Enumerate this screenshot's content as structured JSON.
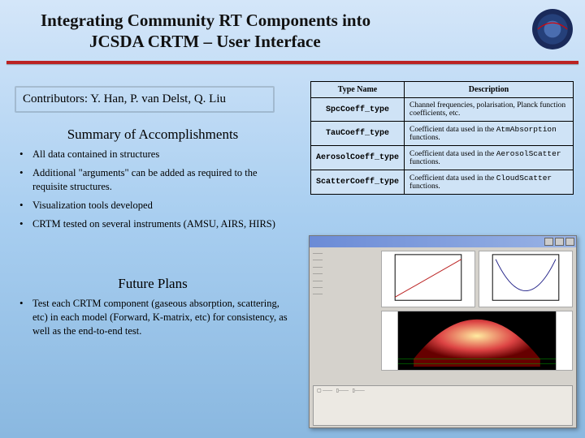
{
  "title_line1": "Integrating Community RT Components into",
  "title_line2": "JCSDA CRTM – User Interface",
  "contributors": "Contributors: Y. Han, P. van Delst, Q. Liu",
  "summary_heading": "Summary of Accomplishments",
  "summary_items": [
    "All data contained in structures",
    "Additional \"arguments\" can be added as required to the requisite structures.",
    "Visualization tools developed",
    "CRTM tested on several instruments (AMSU, AIRS, HIRS)"
  ],
  "future_heading": "Future Plans",
  "future_items": [
    "Test each CRTM component (gaseous absorption, scattering, etc) in each model (Forward, K-matrix, etc) for consistency, as well as the end-to-end test."
  ],
  "table": {
    "headers": [
      "Type Name",
      "Description"
    ],
    "rows": [
      {
        "type": "SpcCoeff_type",
        "desc_pre": "Channel frequencies, polarisation, Planck function coefficients, etc.",
        "mono": "",
        "desc_post": ""
      },
      {
        "type": "TauCoeff_type",
        "desc_pre": "Coefficient data used in the ",
        "mono": "AtmAbsorption",
        "desc_post": " functions."
      },
      {
        "type": "AerosolCoeff_type",
        "desc_pre": "Coefficient data used in the ",
        "mono": "AerosolScatter",
        "desc_post": " functions."
      },
      {
        "type": "ScatterCoeff_type",
        "desc_pre": "Coefficient data used in the ",
        "mono": "CloudScatter",
        "desc_post": " functions."
      }
    ]
  },
  "logo_alt": "JCSDA seal"
}
